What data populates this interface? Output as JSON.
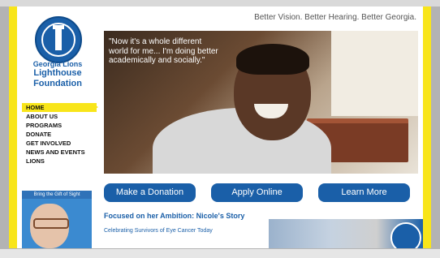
{
  "site": {
    "tagline": "Better Vision. Better Hearing. Better Georgia.",
    "org_line1": "Georgia Lions",
    "org_line2": "Lighthouse",
    "org_line3": "Foundation"
  },
  "nav": {
    "items": [
      "HOME",
      "ABOUT US",
      "PROGRAMS",
      "DONATE",
      "GET INVOLVED",
      "NEWS AND EVENTS",
      "LIONS"
    ],
    "active": "HOME"
  },
  "hero": {
    "quote": "\"Now it's a whole different world for me... I'm doing better academically and socially.\""
  },
  "buttons": {
    "donate": "Make a Donation",
    "apply": "Apply Online",
    "learn": "Learn More"
  },
  "feature": {
    "title": "Focused on her Ambition: Nicole's Story",
    "subtitle": "Celebrating Survivors of Eye Cancer Today"
  },
  "promo": {
    "band_text": "Bring the Gift of Sight"
  },
  "colors": {
    "accent_yellow": "#f8e51a",
    "brand_blue": "#1a5fa8"
  }
}
